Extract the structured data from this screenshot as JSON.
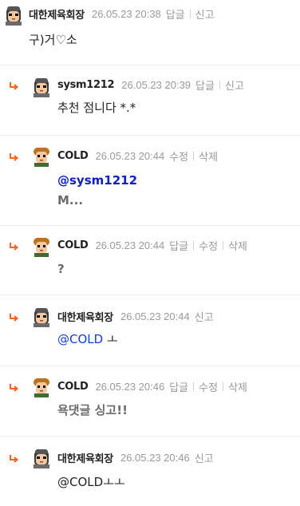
{
  "comments": [
    {
      "nickname": "대한제육회장",
      "date": "26.05.23 20:38",
      "actions": [
        "답글",
        "신고"
      ],
      "is_reply": false,
      "body": "구)거♡소"
    },
    {
      "nickname": "sysm1212",
      "date": "26.05.23 20:39",
      "actions": [
        "답글",
        "신고"
      ],
      "is_reply": true,
      "body": "추천 점니다 *.*"
    },
    {
      "nickname": "COLD",
      "date": "26.05.23 20:44",
      "actions": [
        "수정",
        "삭제"
      ],
      "is_reply": true,
      "mention": "@sysm1212",
      "body": "M..."
    },
    {
      "nickname": "COLD",
      "date": "26.05.23 20:44",
      "actions": [
        "답글",
        "수정",
        "삭제"
      ],
      "is_reply": true,
      "body": "?"
    },
    {
      "nickname": "대한제육회장",
      "date": "26.05.23 20:44",
      "actions": [
        "신고"
      ],
      "is_reply": true,
      "mention": "@COLD",
      "body": " ㅗ"
    },
    {
      "nickname": "COLD",
      "date": "26.05.23 20:46",
      "actions": [
        "답글",
        "수정",
        "삭제"
      ],
      "is_reply": true,
      "body": "욕댓글 싱고!!"
    },
    {
      "nickname": "대한제육회장",
      "date": "26.05.23 20:46",
      "actions": [
        "신고"
      ],
      "is_reply": true,
      "mention": "@COLD",
      "body": "ㅗㅗ"
    }
  ],
  "icons": {
    "reply_arrow": "reply-arrow-icon",
    "avatar": "pixel-character-avatar",
    "reply_arrow_color": "#f26522"
  }
}
